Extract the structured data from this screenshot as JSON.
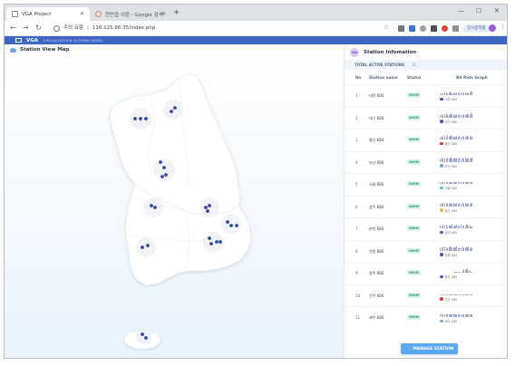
{
  "browser": {
    "tabs": [
      {
        "label": "VGA Project",
        "active": true
      },
      {
        "label": "천안읍 이란 - Google 검색",
        "active": false
      }
    ],
    "window_controls": [
      "—",
      "☐",
      "✕"
    ],
    "address": {
      "security_label": "주의 요함",
      "url": "116.125.66.35/index.php"
    },
    "profile_label": "일시중지됨"
  },
  "app": {
    "brand": "VGA",
    "subtitle": "VIRTUALIZATION GATEWAY ADMIN"
  },
  "map_panel": {
    "title": "Station View Map"
  },
  "side_panel": {
    "title": "Station Infomation",
    "badge": "Sta",
    "total_label": "TOTAL ACTIVE STATIONS",
    "total_count": "11",
    "columns": {
      "no": "No",
      "name": "Station name",
      "status": "Status",
      "graph": "Bit Rate Graph"
    },
    "rows": [
      {
        "no": "1",
        "name": "대전 KBS",
        "status": "NORM",
        "legend": "대전 KBS",
        "dot": "#4a55b8",
        "bars": [
          0.5,
          0.6,
          0.5,
          0.7,
          0.6,
          0.5,
          0.6,
          0.7,
          0.5,
          0.6,
          0.5,
          0.6,
          0.6,
          0.5,
          0.7,
          0.6,
          0.5,
          0.6,
          0.5,
          0.6,
          0.7,
          0.8
        ]
      },
      {
        "no": "2",
        "name": "대구 KBS",
        "status": "NORM",
        "legend": "대구 KBS",
        "dot": "#4a55b8",
        "bars": [
          0.6,
          0.8,
          0.5,
          0.7,
          0.9,
          0.6,
          0.5,
          0.8,
          0.7,
          0.6,
          0.5,
          0.7,
          0.6,
          0.8,
          0.5,
          0.6,
          0.7,
          0.6,
          0.8,
          0.7,
          0.6,
          0.9
        ]
      },
      {
        "no": "3",
        "name": "울산 KBS",
        "status": "NORM",
        "legend": "울산 KBS",
        "dot": "#d8344a",
        "bars": [
          0.7,
          0.9,
          0.6,
          0.8,
          0.7,
          1.0,
          0.6,
          0.8,
          0.9,
          0.7,
          0.6,
          0.8,
          0.7,
          0.9,
          0.6,
          0.8,
          0.7,
          0.6,
          0.9,
          0.7,
          0.8,
          0.6
        ]
      },
      {
        "no": "4",
        "name": "부산 KBS",
        "status": "NORM",
        "legend": "부산 KBS",
        "dot": "#6fa6e6",
        "bars": [
          0.8,
          1.0,
          0.7,
          0.9,
          0.8,
          1.0,
          0.7,
          0.9,
          0.8,
          1.0,
          0.7,
          0.9,
          0.8,
          0.9,
          0.7,
          1.0,
          0.8,
          0.9,
          0.7,
          0.9,
          0.8,
          1.0
        ]
      },
      {
        "no": "5",
        "name": "서울 KBS",
        "status": "NORM",
        "legend": "서울 KBS",
        "dot": "#5cc2c6",
        "bars": [
          0.4,
          0.4,
          0.4,
          0.4,
          0.4,
          0.4,
          0.4,
          0.4,
          0.4,
          0.4,
          0.4,
          0.4,
          0.4,
          0.4,
          0.4,
          0.4,
          0.4,
          0.4,
          0.4,
          0.4,
          0.4,
          0.4
        ]
      },
      {
        "no": "6",
        "name": "광주 KBS",
        "status": "NORM",
        "legend": "광주 KBS",
        "dot": "#e8c04a",
        "bars": [
          0.6,
          0.7,
          0.6,
          0.7,
          0.6,
          0.8,
          0.6,
          0.7,
          0.6,
          0.7,
          0.6,
          0.7,
          0.6,
          0.8,
          0.6,
          0.7,
          0.6,
          0.7,
          0.6,
          0.7,
          0.6,
          0.8
        ]
      },
      {
        "no": "7",
        "name": "춘천 KBS",
        "status": "NORM",
        "legend": "춘천 KBS",
        "dot": "#4a55b8",
        "bars": [
          0.7,
          0.5,
          0.8,
          0.6,
          0.9,
          0.5,
          0.7,
          0.6,
          0.8,
          0.5,
          0.7,
          0.9,
          0.6,
          0.5,
          0.8,
          0.6,
          0.7,
          0.5,
          0.9,
          0.6,
          0.7,
          0.5
        ]
      },
      {
        "no": "8",
        "name": "전원 KBS",
        "status": "NORM",
        "legend": "전원 KBS",
        "dot": "#4a55b8",
        "bars": [
          0.6,
          0.8,
          0.7,
          0.9,
          0.6,
          0.8,
          0.7,
          1.0,
          0.6,
          0.8,
          0.7,
          0.9,
          0.6,
          0.8,
          0.7,
          0.9,
          0.6,
          0.8,
          0.7,
          1.0,
          0.6,
          0.8
        ]
      },
      {
        "no": "9",
        "name": "청주 KBS",
        "status": "NORM",
        "legend": "청주 KBS",
        "dot": "#4a55b8",
        "bars": [
          0,
          0,
          0,
          0,
          0,
          0,
          0,
          0,
          0,
          0,
          0.3,
          0.3,
          0.3,
          0.3,
          0.3,
          0.5,
          0.9,
          0.6,
          0.8,
          0.4,
          0.7,
          0.3
        ]
      },
      {
        "no": "10",
        "name": "진주 KBS",
        "status": "NORM",
        "legend": "진주 KBS",
        "dot": "#d8344a",
        "bars": [
          0.2,
          0.2,
          0.2,
          0.2,
          0.2,
          0.2,
          0.2,
          0.2,
          0.2,
          0.2,
          0.2,
          0.2,
          0.2,
          0.2,
          0.2,
          0.2,
          0.2,
          0.2,
          0.2,
          0.2,
          0.2,
          0.2
        ]
      },
      {
        "no": "11",
        "name": "제주 KBS",
        "status": "NORM",
        "legend": "제주 KBS",
        "dot": "#6fa6e6",
        "bars": [
          0.7,
          0.7,
          0.7,
          0.7,
          0.7,
          0.7,
          0.7,
          0.7,
          0.7,
          0.7,
          0.7,
          0.7,
          0.7,
          0.7,
          0.7,
          0.7,
          0.7,
          0.7,
          0.7,
          0.7,
          0.7,
          0.7
        ]
      }
    ],
    "manage_button": "MANAGE STATION"
  }
}
